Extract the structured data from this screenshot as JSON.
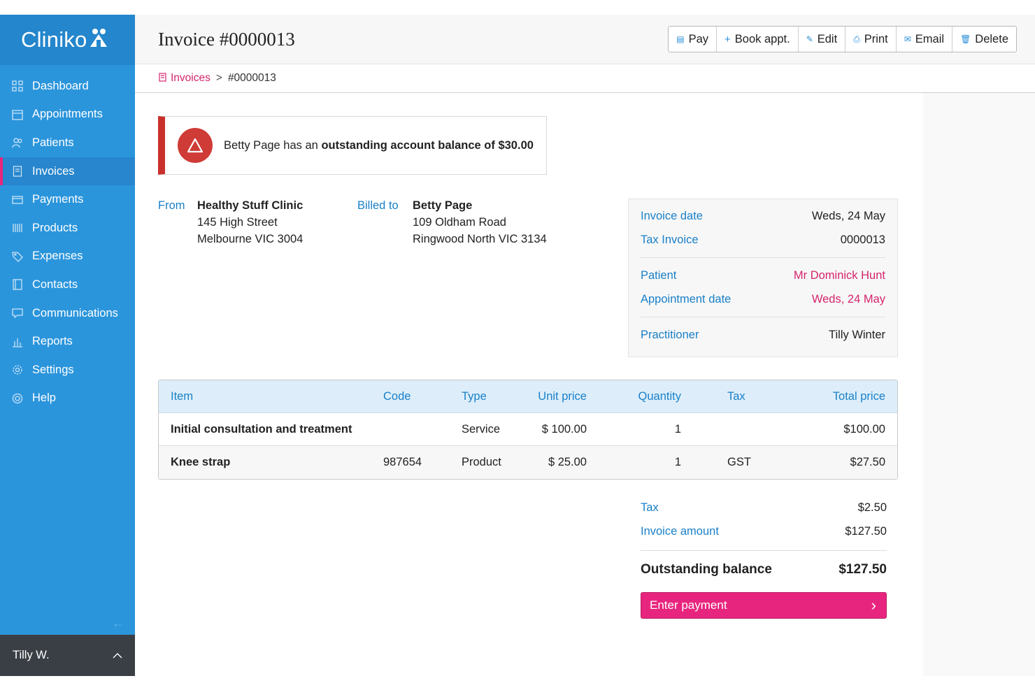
{
  "app": {
    "logo_text": "Cliniko"
  },
  "sidebar": {
    "items": [
      {
        "label": "Dashboard",
        "icon": "grid-icon"
      },
      {
        "label": "Appointments",
        "icon": "calendar-icon"
      },
      {
        "label": "Patients",
        "icon": "users-icon"
      },
      {
        "label": "Invoices",
        "icon": "document-icon",
        "active": true
      },
      {
        "label": "Payments",
        "icon": "card-icon"
      },
      {
        "label": "Products",
        "icon": "barcode-icon"
      },
      {
        "label": "Expenses",
        "icon": "tag-icon"
      },
      {
        "label": "Contacts",
        "icon": "contacts-icon"
      },
      {
        "label": "Communications",
        "icon": "chat-icon"
      },
      {
        "label": "Reports",
        "icon": "bar-chart-icon"
      },
      {
        "label": "Settings",
        "icon": "gear-icon"
      },
      {
        "label": "Help",
        "icon": "lifebuoy-icon"
      }
    ],
    "collapse_glyph": "←",
    "user": {
      "name": "Tilly W.",
      "chevron": "^"
    }
  },
  "header": {
    "title": "Invoice #0000013",
    "toolbar": {
      "pay": "Pay",
      "book": "Book appt.",
      "edit": "Edit",
      "print": "Print",
      "email": "Email",
      "delete": "Delete"
    }
  },
  "breadcrumb": {
    "parent": "Invoices",
    "separator": ">",
    "current": "#0000013"
  },
  "alert": {
    "prefix": "Betty Page has an ",
    "bold": "outstanding account balance of $30.00"
  },
  "from": {
    "label": "From",
    "name": "Healthy Stuff Clinic",
    "line1": "145 High Street",
    "line2": "Melbourne VIC 3004"
  },
  "billed_to": {
    "label": "Billed to",
    "name": "Betty Page",
    "line1": "109 Oldham Road",
    "line2": "Ringwood North VIC 3134"
  },
  "details": {
    "invoice_date_label": "Invoice date",
    "invoice_date": "Weds, 24 May",
    "tax_invoice_label": "Tax Invoice",
    "tax_invoice": "0000013",
    "patient_label": "Patient",
    "patient": "Mr Dominick Hunt",
    "appt_date_label": "Appointment date",
    "appt_date": "Weds, 24 May",
    "practitioner_label": "Practitioner",
    "practitioner": "Tilly Winter"
  },
  "table": {
    "headers": {
      "item": "Item",
      "code": "Code",
      "type": "Type",
      "unit": "Unit price",
      "qty": "Quantity",
      "tax": "Tax",
      "total": "Total price"
    },
    "rows": [
      {
        "item": "Initial consultation and treatment",
        "code": "",
        "type": "Service",
        "unit": "$ 100.00",
        "qty": "1",
        "tax": "",
        "total": "$100.00"
      },
      {
        "item": "Knee strap",
        "code": "987654",
        "type": "Product",
        "unit": "$ 25.00",
        "qty": "1",
        "tax": "GST",
        "total": "$27.50"
      }
    ]
  },
  "totals": {
    "tax_label": "Tax",
    "tax": "$2.50",
    "amount_label": "Invoice amount",
    "amount": "$127.50",
    "outstanding_label": "Outstanding balance",
    "outstanding": "$127.50",
    "pay_button": "Enter payment",
    "pay_chevron": "›"
  },
  "colors": {
    "sidebar": "#2b95dc",
    "accent_pink": "#e8257e",
    "link_blue": "#1a80c8",
    "alert_red": "#c9302c"
  }
}
